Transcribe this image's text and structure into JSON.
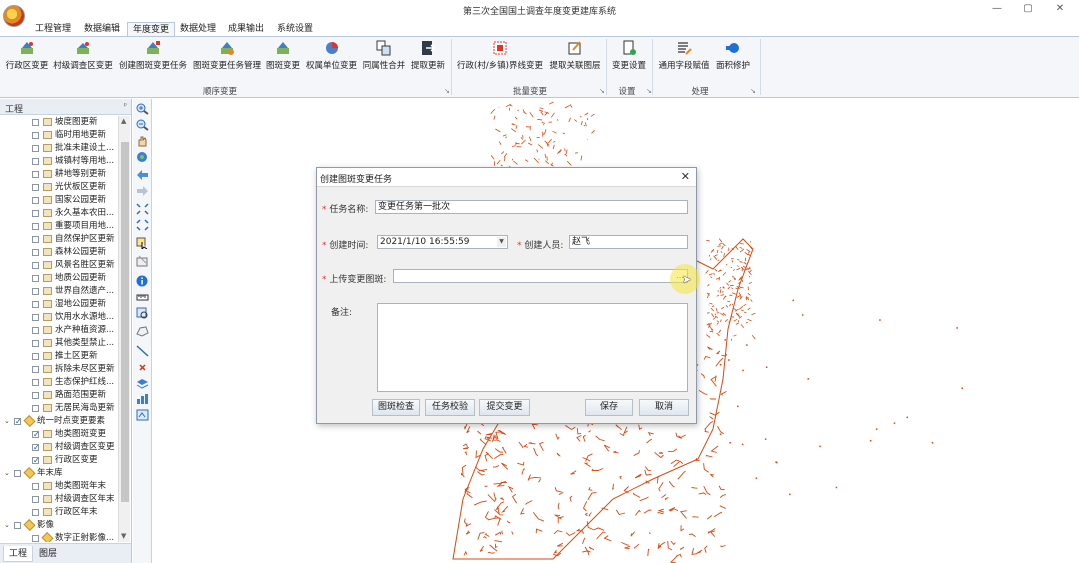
{
  "window": {
    "title": "第三次全国国土调查年度变更建库系统",
    "controls": [
      "—",
      "▢",
      "✕"
    ]
  },
  "menu": {
    "tabs": [
      "工程管理",
      "数据编辑",
      "年度变更",
      "数据处理",
      "成果输出",
      "系统设置"
    ],
    "active_index": 2
  },
  "ribbon": {
    "buttons": [
      {
        "label": "行政区变更",
        "icon": "admin-region-change-icon"
      },
      {
        "label": "村级调查区变更",
        "icon": "village-survey-change-icon"
      },
      {
        "label": "创建图斑变更任务",
        "icon": "create-task-icon"
      },
      {
        "label": "图斑变更任务管理",
        "icon": "task-manage-icon"
      },
      {
        "label": "图斑变更",
        "icon": "patch-change-icon"
      },
      {
        "label": "权属单位变更",
        "icon": "ownership-change-icon"
      },
      {
        "label": "同属性合并",
        "icon": "merge-icon"
      },
      {
        "label": "提取更新",
        "icon": "extract-update-icon"
      },
      {
        "label": "行政(村/乡镇)界线变更",
        "icon": "boundary-change-icon"
      },
      {
        "label": "提取关联图层",
        "icon": "extract-layer-icon"
      },
      {
        "label": "变更设置",
        "icon": "change-settings-icon"
      },
      {
        "label": "通用字段赋值",
        "icon": "field-assign-icon"
      },
      {
        "label": "面积修护",
        "icon": "area-repair-icon"
      }
    ],
    "groups": [
      "顺序变更",
      "批量变更",
      "设置",
      "处理"
    ]
  },
  "left_panel": {
    "title": "工程",
    "tree": [
      {
        "label": "坡度图更新",
        "level": 2,
        "checked": false
      },
      {
        "label": "临时用地更新",
        "level": 2,
        "checked": false
      },
      {
        "label": "批准未建设土...",
        "level": 2,
        "checked": false
      },
      {
        "label": "城镇村等用地...",
        "level": 2,
        "checked": false
      },
      {
        "label": "耕地等别更新",
        "level": 2,
        "checked": false
      },
      {
        "label": "光伏板区更新",
        "level": 2,
        "checked": false
      },
      {
        "label": "国家公园更新",
        "level": 2,
        "checked": false
      },
      {
        "label": "永久基本农田...",
        "level": 2,
        "checked": false
      },
      {
        "label": "重要项目用地...",
        "level": 2,
        "checked": false
      },
      {
        "label": "自然保护区更新",
        "level": 2,
        "checked": false
      },
      {
        "label": "森林公园更新",
        "level": 2,
        "checked": false
      },
      {
        "label": "风景名胜区更新",
        "level": 2,
        "checked": false
      },
      {
        "label": "地质公园更新",
        "level": 2,
        "checked": false
      },
      {
        "label": "世界自然遗产...",
        "level": 2,
        "checked": false
      },
      {
        "label": "湿地公园更新",
        "level": 2,
        "checked": false
      },
      {
        "label": "饮用水水源地...",
        "level": 2,
        "checked": false
      },
      {
        "label": "水产种植资源...",
        "level": 2,
        "checked": false
      },
      {
        "label": "其他类型禁止...",
        "level": 2,
        "checked": false
      },
      {
        "label": "推土区更新",
        "level": 2,
        "checked": false
      },
      {
        "label": "拆除未尽区更新",
        "level": 2,
        "checked": false
      },
      {
        "label": "生态保护红线...",
        "level": 2,
        "checked": false
      },
      {
        "label": "路面范围更新",
        "level": 2,
        "checked": false
      },
      {
        "label": "无居民海岛更新",
        "level": 2,
        "checked": false
      },
      {
        "label": "统一时点变更要素",
        "level": 1,
        "checked": true,
        "group": true
      },
      {
        "label": "地类图斑变更",
        "level": 2,
        "checked": true
      },
      {
        "label": "村级调查区变更",
        "level": 2,
        "checked": true
      },
      {
        "label": "行政区变更",
        "level": 2,
        "checked": true
      },
      {
        "label": "年末库",
        "level": 1,
        "checked": false,
        "group": true
      },
      {
        "label": "地类图斑年末",
        "level": 2,
        "checked": false
      },
      {
        "label": "村级调查区年末",
        "level": 2,
        "checked": false
      },
      {
        "label": "行政区年末",
        "level": 2,
        "checked": false
      },
      {
        "label": "影像",
        "level": 1,
        "checked": false,
        "group": true
      },
      {
        "label": "数字正射影像...",
        "level": 2,
        "checked": false,
        "group_icon": true
      }
    ],
    "bottom_tabs": [
      "工程",
      "图层"
    ]
  },
  "dialog": {
    "title": "创建图斑变更任务",
    "fields": {
      "task_name_label": "任务名称:",
      "task_name_value": "变更任务第一批次",
      "created_time_label": "创建时间:",
      "created_time_value": "2021/1/10 16:55:59",
      "creator_label": "创建人员:",
      "creator_value": "赵飞",
      "upload_label": "上传变更图斑:",
      "upload_value": "",
      "remark_label": "备注:",
      "remark_value": ""
    },
    "buttons": {
      "check": "图斑检查",
      "verify": "任务校验",
      "submit": "提交变更",
      "save": "保存",
      "cancel": "取消"
    },
    "close": "✕",
    "required_mark": "*"
  },
  "colors": {
    "map_feature": "#d9480f",
    "ribbon_bg": "#f4f6f9",
    "border": "#b9c9da"
  }
}
